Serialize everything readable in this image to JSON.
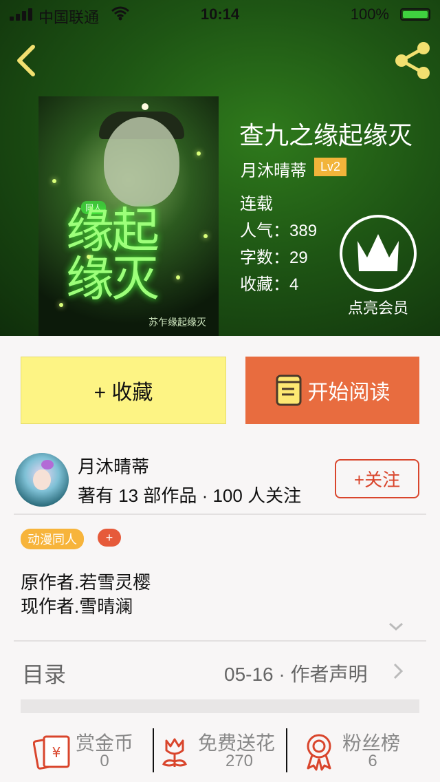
{
  "status_bar": {
    "carrier": "中国联通",
    "time": "10:14",
    "battery": "100%",
    "battery_color": "#3fd13f"
  },
  "header": {
    "back_icon": "chevron-left-icon",
    "share_icon": "share-icon",
    "icon_color": "#f2e070"
  },
  "book": {
    "title": "查九之缘起缘灭",
    "author": "月沐晴蒂",
    "level": "Lv2",
    "status": "连载",
    "popularity_label": "人气：",
    "popularity_value": "389",
    "words_label": "字数：",
    "words_value": "29",
    "favorites_label": "收藏：",
    "favorites_value": "4",
    "vip_label": "点亮会员"
  },
  "actions": {
    "collect_label": "+ 收藏",
    "read_label": "开始阅读",
    "collect_color": "#fdf484",
    "read_color": "#e86c3f"
  },
  "author_card": {
    "name": "月沐晴蒂",
    "stats": "著有 13 部作品 · 100 人关注",
    "follow_label": "+关注",
    "follow_color": "#d9452c"
  },
  "tags": {
    "items": [
      "动漫同人"
    ],
    "add_label": "+",
    "tag_color": "#f7b43b"
  },
  "description": {
    "line1": "原作者.若雪灵樱",
    "line2": "现作者.雪晴澜"
  },
  "catalog": {
    "label": "目录",
    "latest": "05-16 · 作者声明"
  },
  "bottom_bar": {
    "reward_label": "赏金币",
    "reward_value": "0",
    "flower_label": "免费送花",
    "flower_value": "270",
    "fans_label": "粉丝榜",
    "fans_value": "6",
    "icon_color": "#d9452c"
  }
}
